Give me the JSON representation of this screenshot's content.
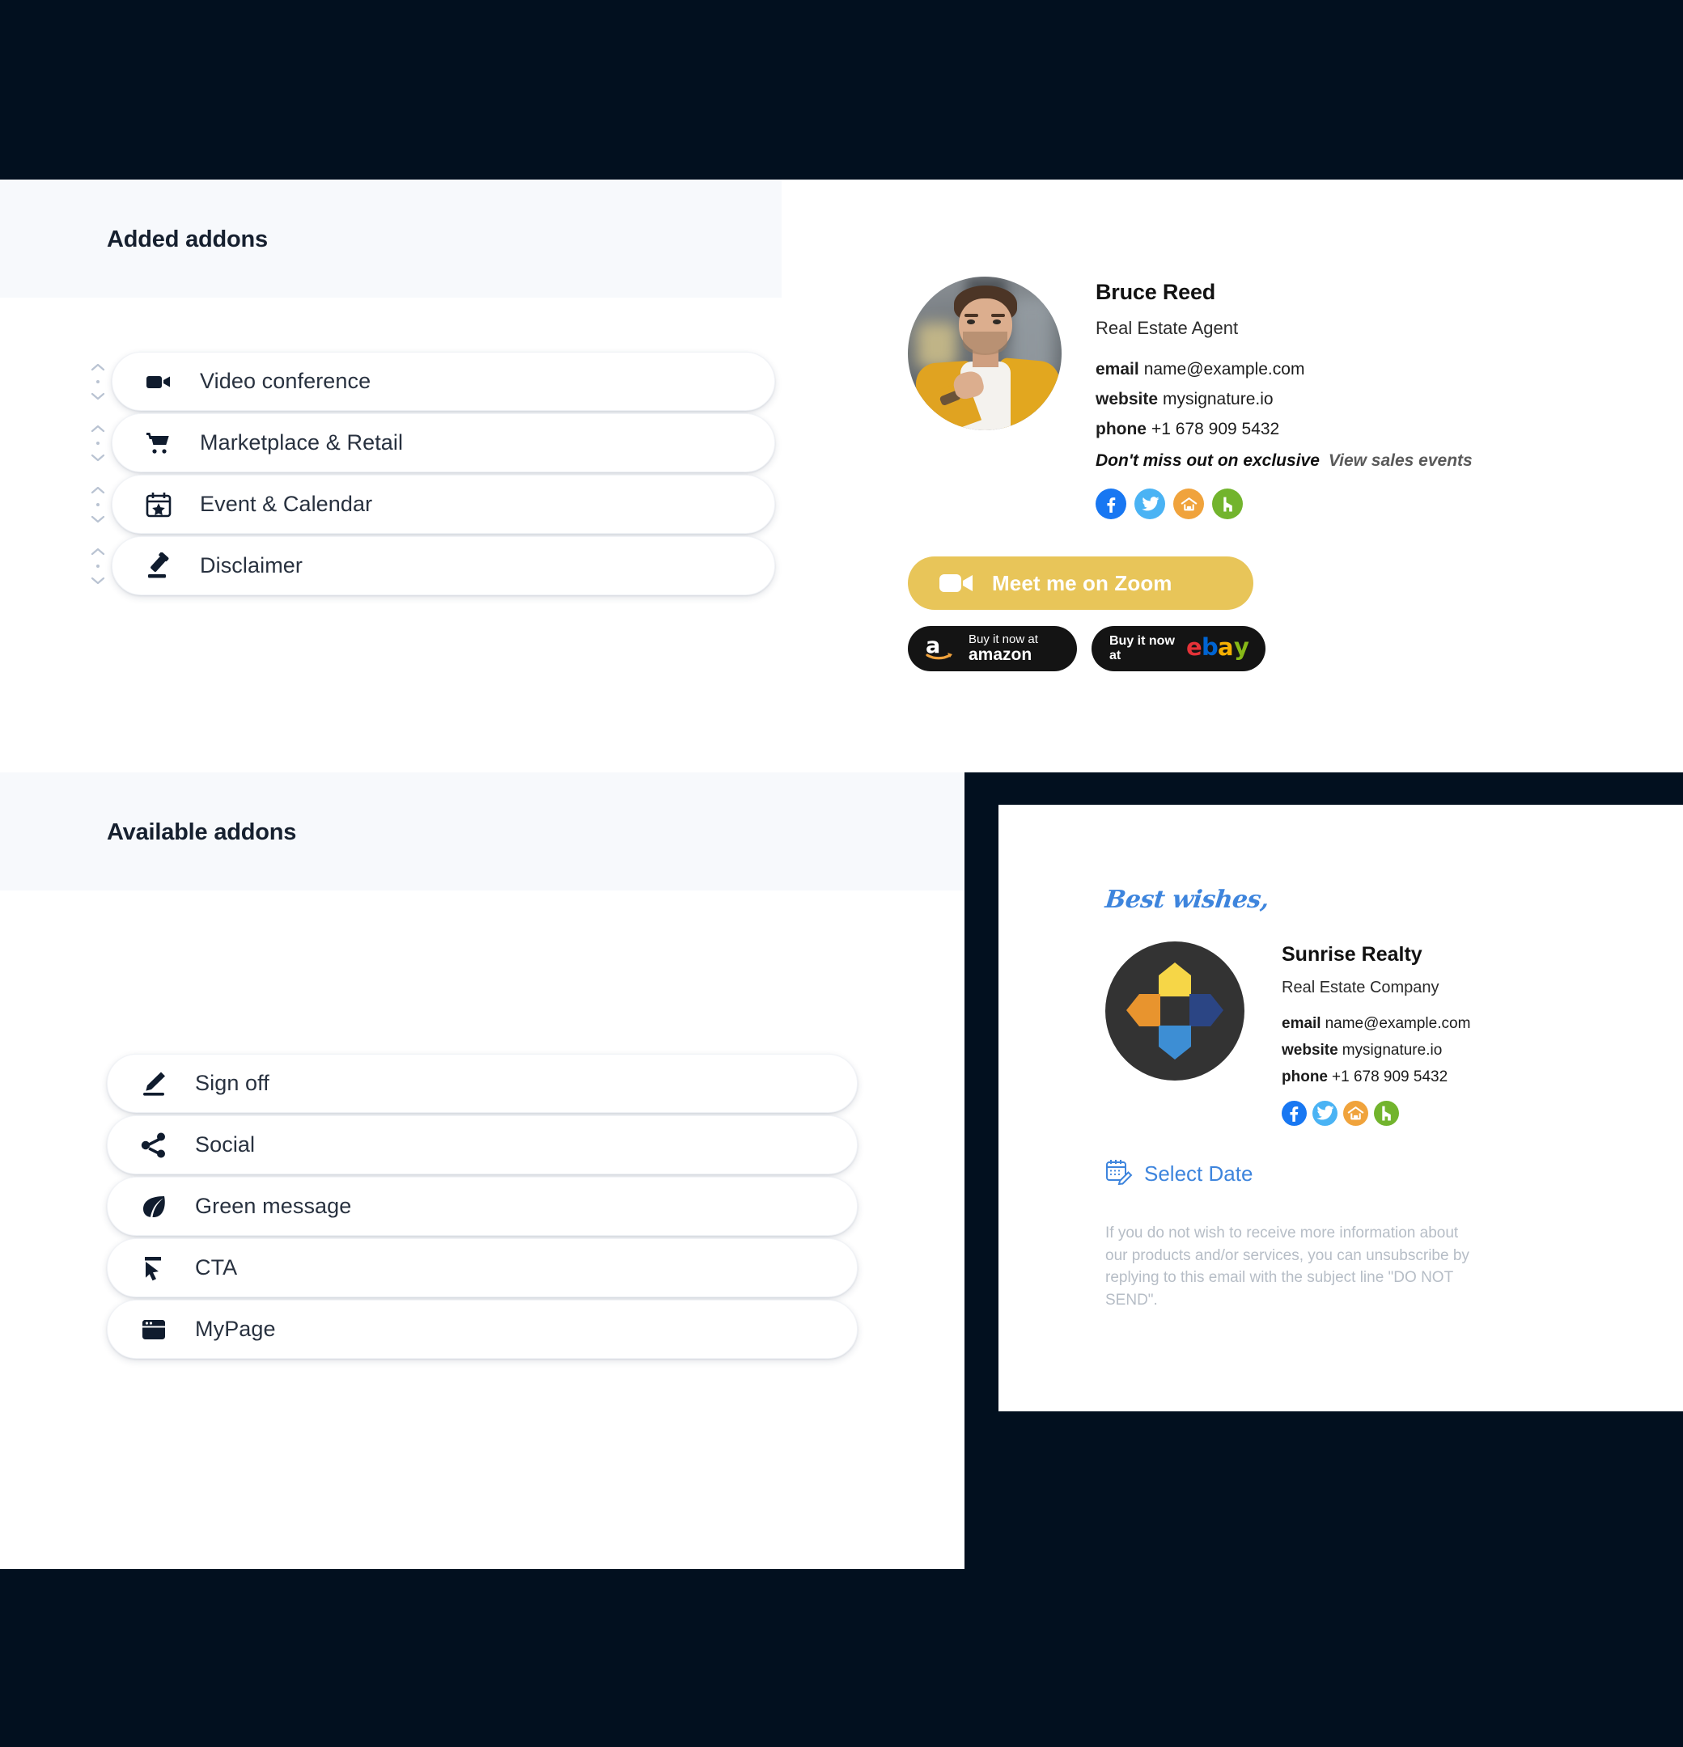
{
  "theme": {
    "background": "#02101f",
    "panel_bg": "#ffffff",
    "header_bg": "#f7f9fc",
    "accent_yellow": "#e8c559",
    "link_blue": "#3e85dd",
    "facebook": "#1877f2",
    "twitter": "#4ab3f4",
    "zillow": "#f0a33c",
    "houzz": "#72b42d"
  },
  "added_addons_panel": {
    "title": "Added addons",
    "items": [
      {
        "label": "Video conference",
        "icon": "video-camera-icon"
      },
      {
        "label": "Marketplace & Retail",
        "icon": "shopping-cart-icon"
      },
      {
        "label": "Event & Calendar",
        "icon": "calendar-star-icon"
      },
      {
        "label": "Disclaimer",
        "icon": "gavel-icon"
      }
    ]
  },
  "available_addons_panel": {
    "title": "Available addons",
    "items": [
      {
        "label": "Sign off",
        "icon": "pen-signature-icon"
      },
      {
        "label": "Social",
        "icon": "share-nodes-icon"
      },
      {
        "label": "Green message",
        "icon": "leaf-icon"
      },
      {
        "label": "CTA",
        "icon": "cursor-arrow-icon"
      },
      {
        "label": "MyPage",
        "icon": "browser-window-icon"
      }
    ]
  },
  "signature_personal": {
    "name": "Bruce Reed",
    "role": "Real Estate Agent",
    "fields": [
      {
        "label": "email",
        "value": "name@example.com"
      },
      {
        "label": "website",
        "value": "mysignature.io"
      },
      {
        "label": "phone",
        "value": "+1 678 909 5432"
      }
    ],
    "promo_text": "Don't miss out on exclusive",
    "promo_link": "View sales events",
    "socials": [
      "facebook-icon",
      "twitter-icon",
      "zillow-icon",
      "houzz-icon"
    ],
    "zoom_button": "Meet me on Zoom",
    "amazon_button": {
      "line1": "Buy it now at",
      "line2": "amazon"
    },
    "ebay_button": {
      "prefix": "Buy it now at",
      "brand": "ebay"
    }
  },
  "signature_company": {
    "sign_off": "Best wishes,",
    "name": "Sunrise Realty",
    "role": "Real Estate Company",
    "fields": [
      {
        "label": "email",
        "value": "name@example.com"
      },
      {
        "label": "website",
        "value": "mysignature.io"
      },
      {
        "label": "phone",
        "value": "+1 678 909 5432"
      }
    ],
    "socials": [
      "facebook-icon",
      "twitter-icon",
      "zillow-icon",
      "houzz-icon"
    ],
    "select_date_label": "Select Date",
    "unsubscribe_text": "If you do not wish to receive more information about our products and/or services, you can unsubscribe by replying to this email with the subject line \"DO NOT SEND\"."
  }
}
